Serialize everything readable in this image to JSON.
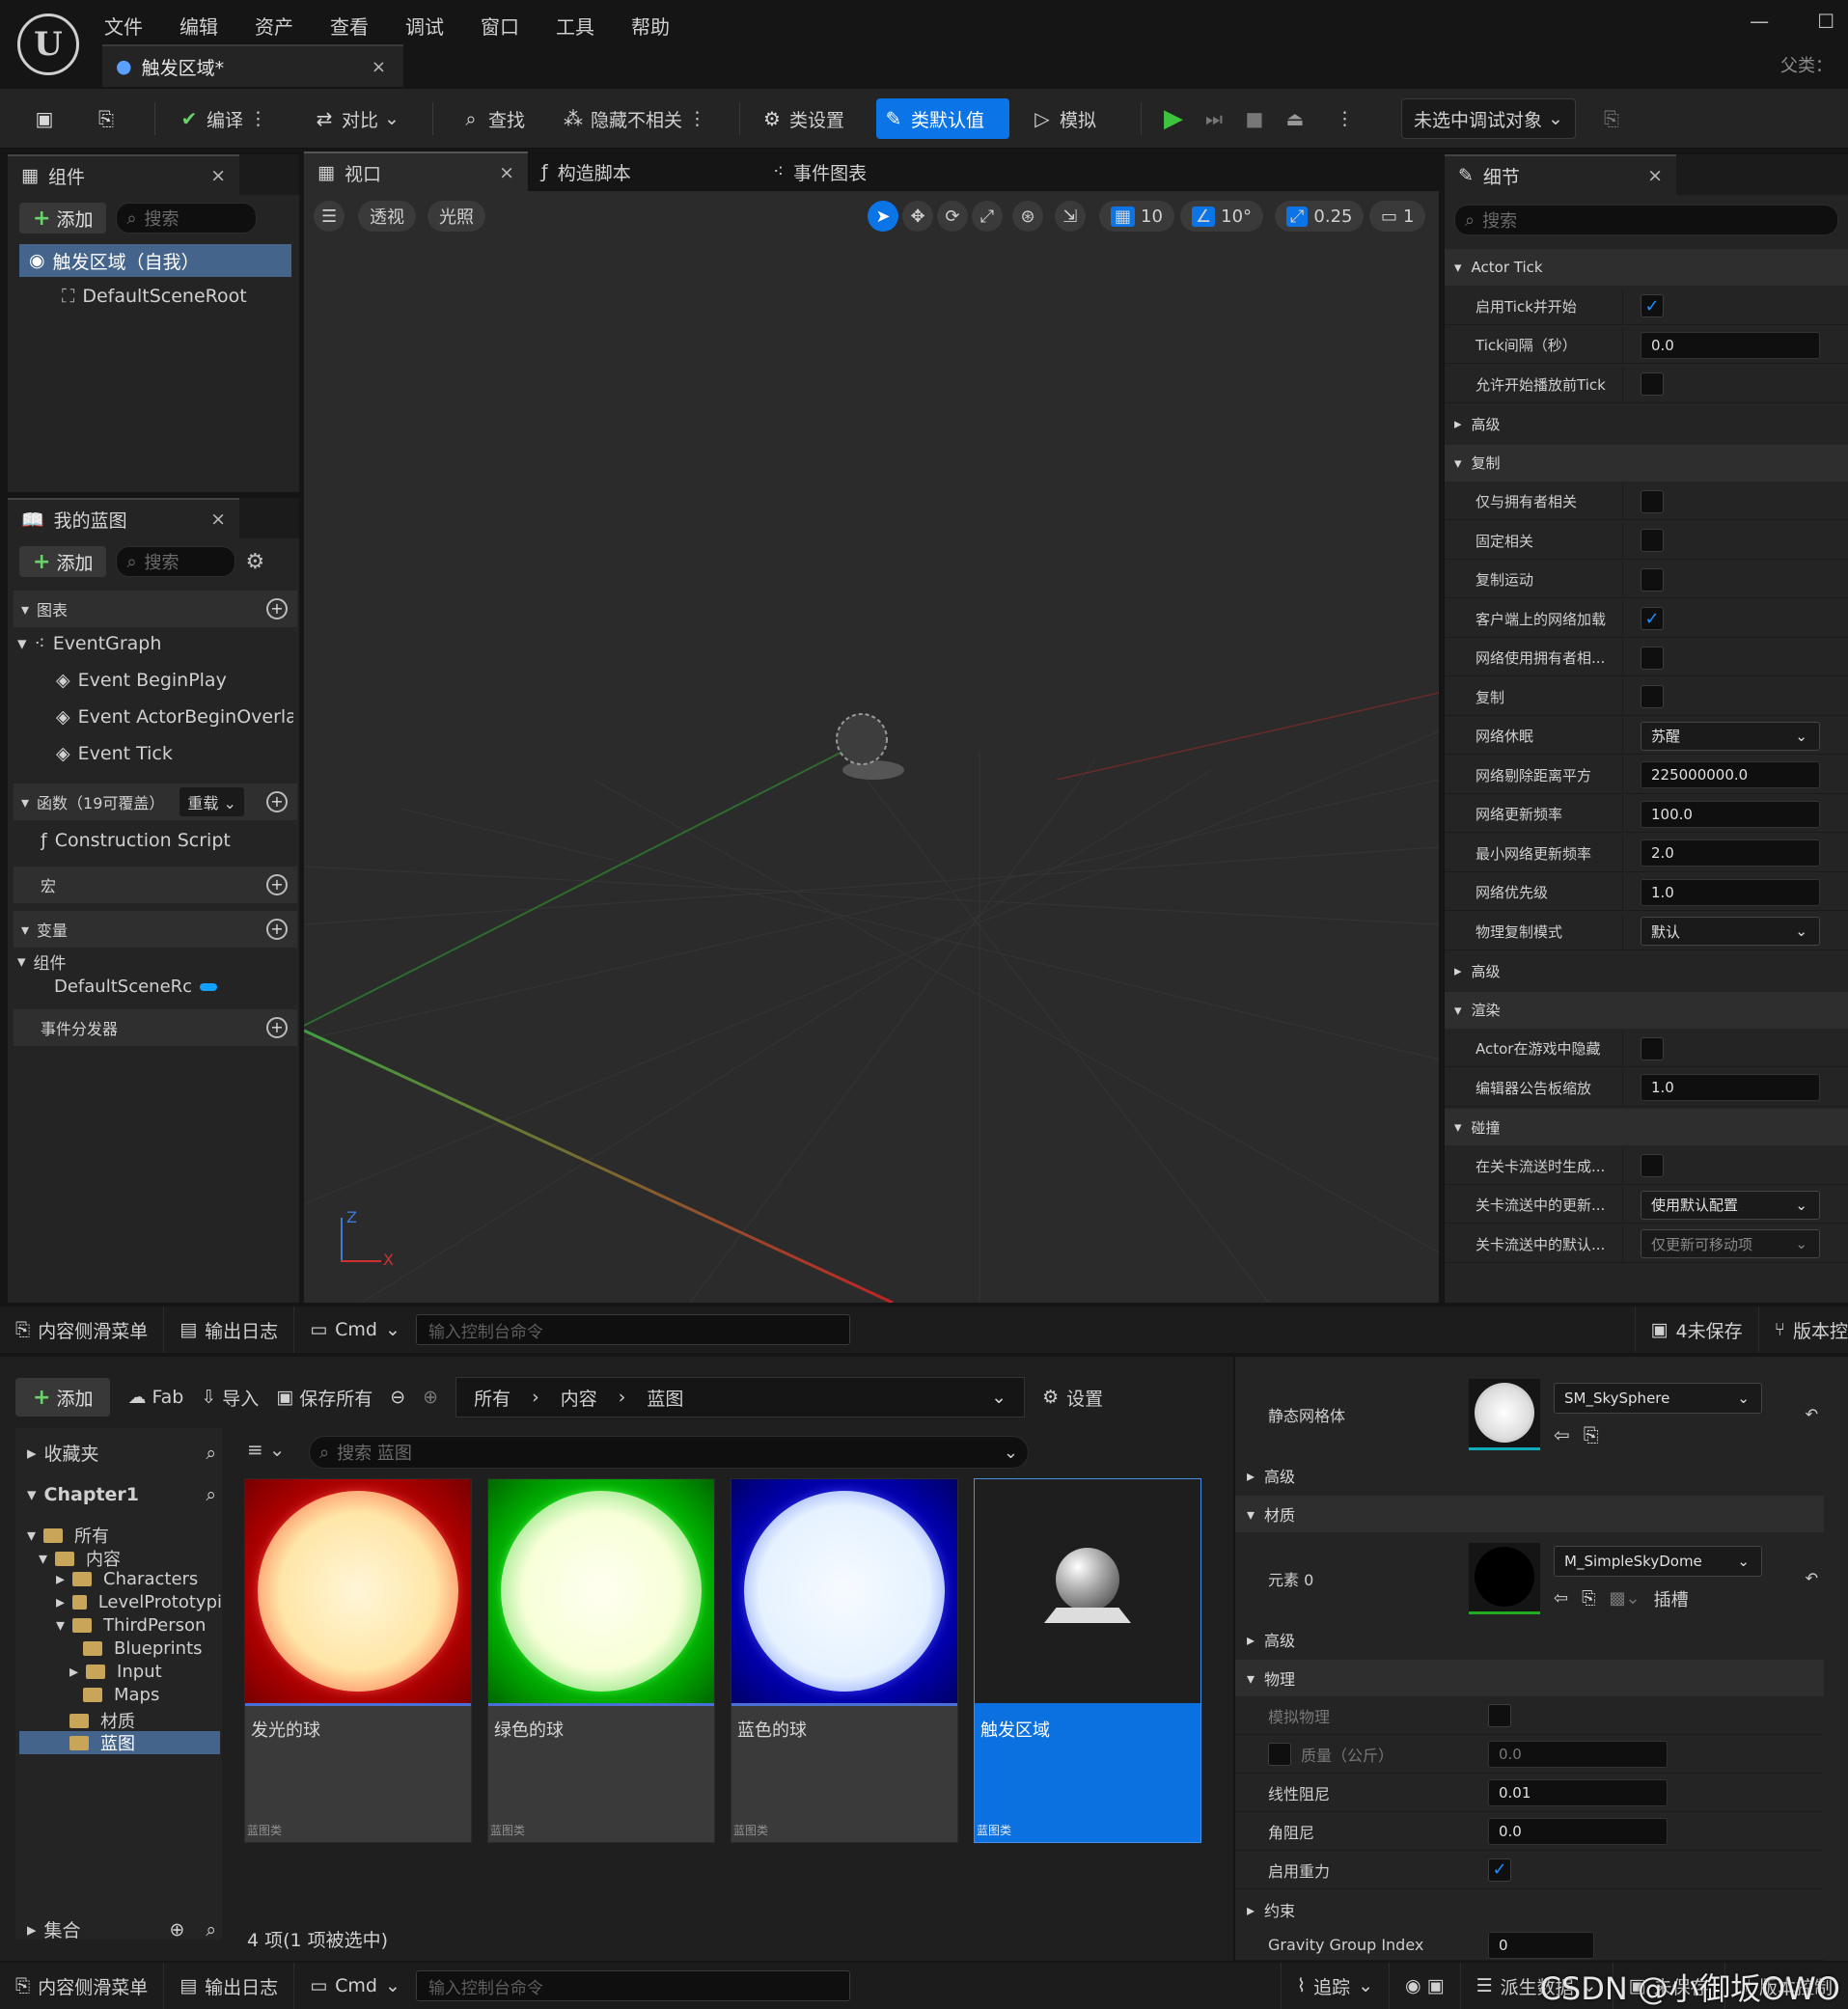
{
  "menu": [
    "文件",
    "编辑",
    "资产",
    "查看",
    "调试",
    "窗口",
    "工具",
    "帮助"
  ],
  "doc_tab": {
    "title": "触发区域*",
    "close": "×"
  },
  "window_controls": {
    "minimize": "—",
    "maximize": "☐"
  },
  "parent_label": "父类：",
  "toolbar": {
    "compile": "编译",
    "diff": "对比",
    "find": "查找",
    "hide_unrelated": "隐藏不相关",
    "class_settings": "类设置",
    "class_defaults": "类默认值",
    "simulate": "模拟",
    "debug_target": "未选中调试对象"
  },
  "components_panel": {
    "title": "组件",
    "close": "×",
    "add": "添加",
    "search_placeholder": "搜索",
    "items": [
      "触发区域（自我）",
      "DefaultSceneRoot"
    ]
  },
  "my_blueprint": {
    "title": "我的蓝图",
    "close": "×",
    "add": "添加",
    "search_placeholder": "搜索",
    "graphs_header": "图表",
    "event_graph": "EventGraph",
    "events": [
      "Event BeginPlay",
      "Event ActorBeginOverlap",
      "Event Tick"
    ],
    "functions_header": "函数（19可覆盖）",
    "override": "重载",
    "construction_script": "Construction Script",
    "macros_header": "宏",
    "variables_header": "变量",
    "components_header": "组件",
    "component_var": "DefaultSceneRc",
    "dispatchers_header": "事件分发器"
  },
  "center_tabs": [
    "视口",
    "构造脚本",
    "事件图表"
  ],
  "viewport": {
    "perspective": "透视",
    "lit": "光照",
    "grid_snap": "10",
    "rot_snap": "10°",
    "scale_snap": "0.25",
    "camera_speed": "1",
    "axis_z": "Z",
    "axis_x": "X"
  },
  "details": {
    "title": "细节",
    "close": "×",
    "search_placeholder": "搜索",
    "sections": [
      {
        "header": "Actor Tick",
        "rows": [
          {
            "label": "启用Tick并开始",
            "type": "check",
            "value": "✓"
          },
          {
            "label": "Tick间隔（秒）",
            "type": "num",
            "value": "0.0"
          },
          {
            "label": "允许开始播放前Tick",
            "type": "check",
            "value": ""
          }
        ]
      },
      {
        "header": "高级",
        "collapsed": true,
        "rows": []
      },
      {
        "header": "复制",
        "rows": [
          {
            "label": "仅与拥有者相关",
            "type": "check",
            "value": ""
          },
          {
            "label": "固定相关",
            "type": "check",
            "value": ""
          },
          {
            "label": "复制运动",
            "type": "check",
            "value": ""
          },
          {
            "label": "客户端上的网络加载",
            "type": "check",
            "value": "✓"
          },
          {
            "label": "网络使用拥有者相...",
            "type": "check",
            "value": ""
          },
          {
            "label": "复制",
            "type": "check",
            "value": ""
          },
          {
            "label": "网络休眠",
            "type": "dd",
            "value": "苏醒"
          },
          {
            "label": "网络剔除距离平方",
            "type": "num",
            "value": "225000000.0"
          },
          {
            "label": "网络更新频率",
            "type": "num",
            "value": "100.0"
          },
          {
            "label": "最小网络更新频率",
            "type": "num",
            "value": "2.0"
          },
          {
            "label": "网络优先级",
            "type": "num",
            "value": "1.0"
          },
          {
            "label": "物理复制模式",
            "type": "dd",
            "value": "默认"
          }
        ]
      },
      {
        "header": "高级",
        "collapsed": true,
        "rows": []
      },
      {
        "header": "渲染",
        "rows": [
          {
            "label": "Actor在游戏中隐藏",
            "type": "check",
            "value": ""
          },
          {
            "label": "编辑器公告板缩放",
            "type": "num",
            "value": "1.0"
          }
        ]
      },
      {
        "header": "碰撞",
        "rows": [
          {
            "label": "在关卡流送时生成...",
            "type": "check",
            "value": ""
          },
          {
            "label": "关卡流送中的更新...",
            "type": "dd",
            "value": "使用默认配置"
          },
          {
            "label": "关卡流送中的默认...",
            "type": "dd",
            "value": "仅更新可移动项"
          }
        ]
      }
    ]
  },
  "bottom_bar_top": {
    "content_drawer": "内容侧滑菜单",
    "output_log": "输出日志",
    "cmd": "Cmd",
    "console_placeholder": "输入控制台命令",
    "unsaved": "4未保存",
    "source_control": "版本控"
  },
  "content_browser": {
    "add": "添加",
    "fab": "Fab",
    "import": "导入",
    "save_all": "保存所有",
    "path": [
      "所有",
      "内容",
      "蓝图"
    ],
    "settings": "设置",
    "search_placeholder": "搜索 蓝图",
    "favorites": "收藏夹",
    "chapter": "Chapter1",
    "tree": [
      "所有",
      "内容",
      "Characters",
      "LevelPrototypi",
      "ThirdPerson",
      "Blueprints",
      "Input",
      "Maps",
      "材质",
      "蓝图"
    ],
    "collections": "集合",
    "assets": [
      {
        "name": "发光的球",
        "kind": "蓝图类",
        "color": "#e01010"
      },
      {
        "name": "绿色的球",
        "kind": "蓝图类",
        "color": "#10c010"
      },
      {
        "name": "蓝色的球",
        "kind": "蓝图类",
        "color": "#1010d0"
      },
      {
        "name": "触发区域",
        "kind": "蓝图类",
        "color": "#202020"
      }
    ],
    "status": "4 项(1 项被选中)"
  },
  "right_details2": {
    "static_mesh_label": "静态网格体",
    "static_mesh_value": "SM_SkySphere",
    "advanced": "高级",
    "materials_header": "材质",
    "element0": "元素 0",
    "material_value": "M_SimpleSkyDome",
    "slot": "插槽",
    "physics_header": "物理",
    "simulate_physics": "模拟物理",
    "mass": "质量（公斤）",
    "mass_value": "0.0",
    "linear_damping": "线性阻尼",
    "linear_damping_value": "0.01",
    "angular_damping": "角阻尼",
    "angular_damping_value": "0.0",
    "enable_gravity": "启用重力",
    "constraints": "约束",
    "gravity_group": "Gravity Group Index",
    "gravity_group_value": "0"
  },
  "bottom_bar": {
    "content_drawer": "内容侧滑菜单",
    "output_log": "输出日志",
    "cmd": "Cmd",
    "console_placeholder": "输入控制台命令",
    "trace": "追踪",
    "derived_data": "派生数据",
    "unsaved": "未保存",
    "source_control": "版本控制"
  },
  "watermark": "CSDN @小御坂OWO"
}
